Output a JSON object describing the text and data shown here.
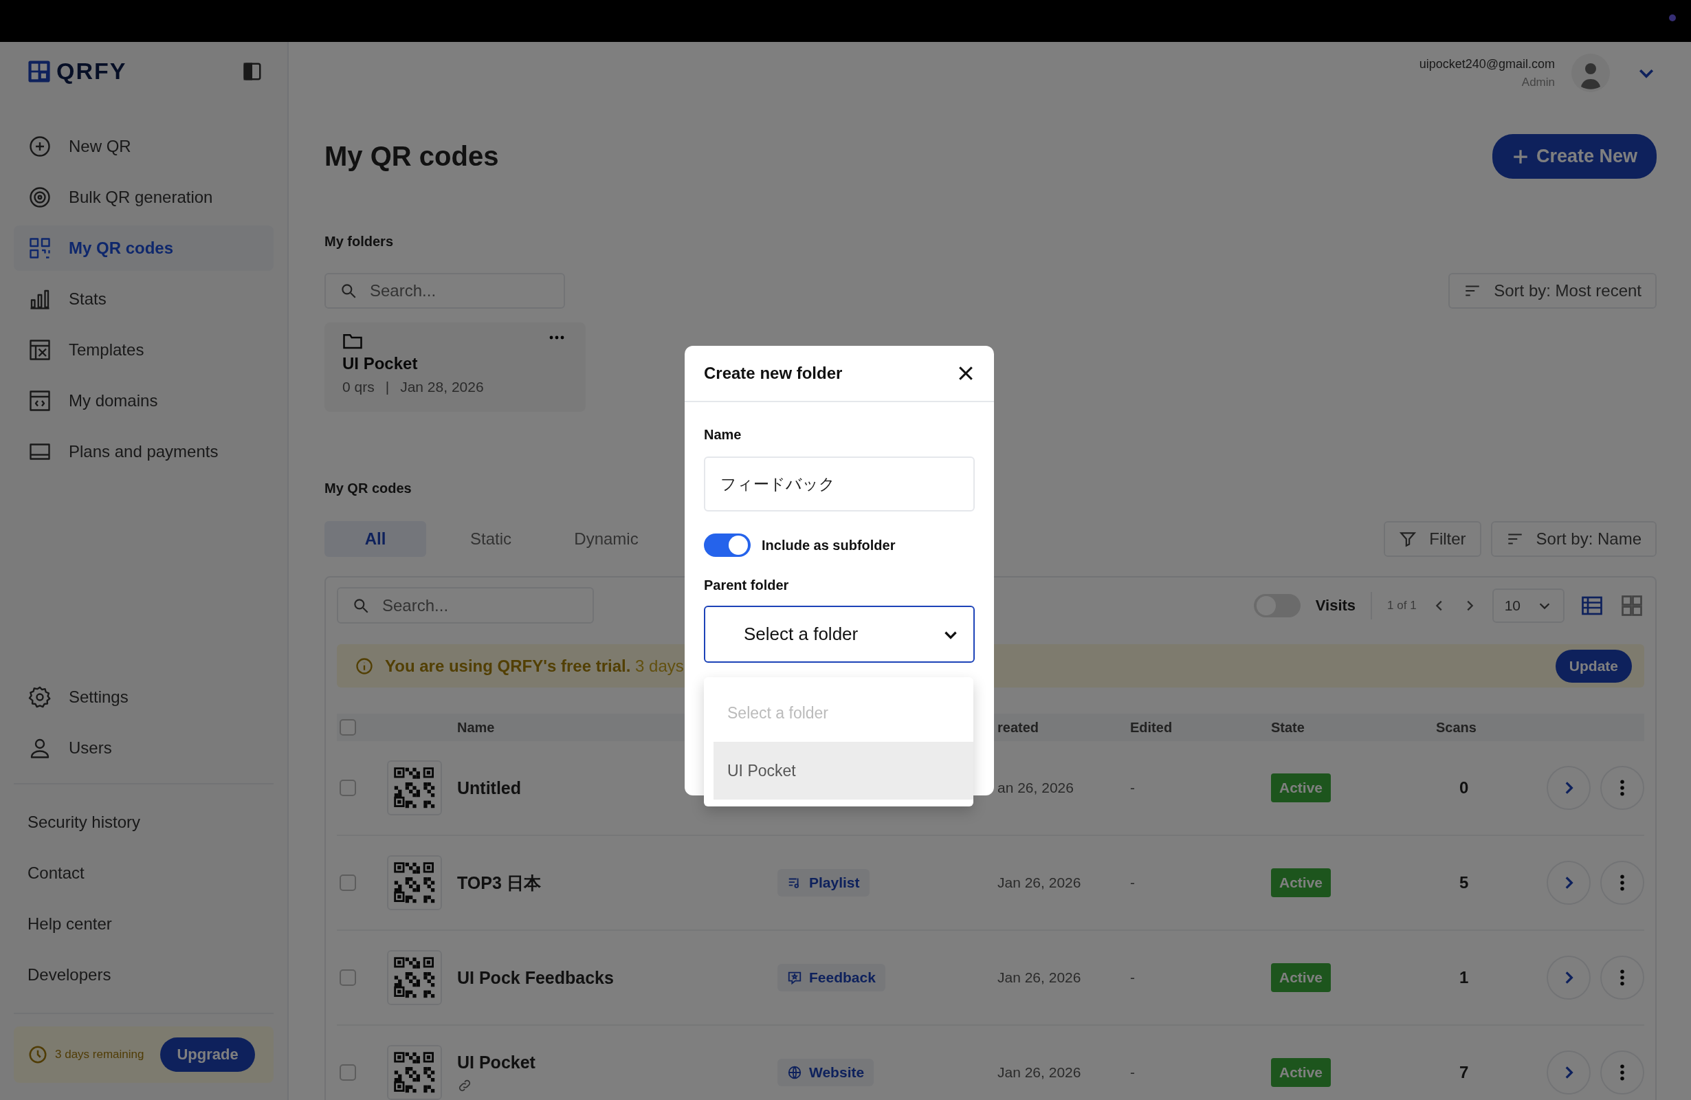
{
  "logo": {
    "text": "QRFY"
  },
  "sidebar": {
    "nav": [
      {
        "label": "New QR",
        "selected": false
      },
      {
        "label": "Bulk QR generation",
        "selected": false
      },
      {
        "label": "My QR codes",
        "selected": true
      },
      {
        "label": "Stats",
        "selected": false
      },
      {
        "label": "Templates",
        "selected": false
      },
      {
        "label": "My domains",
        "selected": false
      },
      {
        "label": "Plans and payments",
        "selected": false
      }
    ],
    "settings": [
      {
        "label": "Settings",
        "selected": false
      },
      {
        "label": "Users",
        "selected": false
      }
    ],
    "links": [
      "Security history",
      "Contact",
      "Help center",
      "Developers"
    ],
    "trial": {
      "text": "3 days remaining",
      "button": "Upgrade"
    }
  },
  "user": {
    "email": "uipocket240@gmail.com",
    "role": "Admin"
  },
  "page": {
    "title": "My QR codes",
    "create_button": "Create New"
  },
  "folders": {
    "label": "My folders",
    "search_placeholder": "Search...",
    "sort": "Sort by: Most recent",
    "items": [
      {
        "name": "UI Pocket",
        "count": "0 qrs",
        "separator": "|",
        "date": "Jan 28, 2026"
      }
    ]
  },
  "qr_codes": {
    "label": "My QR codes",
    "tabs": [
      {
        "label": "All",
        "selected": true
      },
      {
        "label": "Static",
        "selected": false
      },
      {
        "label": "Dynamic",
        "selected": false
      }
    ],
    "filter": "Filter",
    "sort": "Sort by: Name",
    "search_placeholder": "Search...",
    "visits": {
      "label": "Visits",
      "on": false
    },
    "pagination": "1 of 1",
    "page_size": "10",
    "views": [
      {
        "kind": "list",
        "selected": true
      },
      {
        "kind": "grid",
        "selected": false
      }
    ],
    "banner": {
      "text": "**You are using QRFY's free trial.** 3 days",
      "button": "Update"
    },
    "header_checked": false,
    "columns": [
      {
        "kind": "name",
        "label": "Name"
      },
      {
        "kind": "created",
        "label": "reated"
      },
      {
        "kind": "edited",
        "label": "Edited"
      },
      {
        "kind": "state",
        "label": "State"
      },
      {
        "kind": "scans",
        "label": "Scans"
      }
    ],
    "rows": [
      {
        "name": "Untitled",
        "checked": false,
        "created": "an 26, 2026",
        "edited": "-",
        "state": "Active",
        "scans": "0",
        "link": false
      },
      {
        "name": "TOP3 日本",
        "checked": false,
        "type": {
          "kind": "playlist",
          "label": "Playlist"
        },
        "created": "Jan 26, 2026",
        "edited": "-",
        "state": "Active",
        "scans": "5",
        "link": false
      },
      {
        "name": "UI Pock Feedbacks",
        "checked": false,
        "type": {
          "kind": "feedback",
          "label": "Feedback"
        },
        "created": "Jan 26, 2026",
        "edited": "-",
        "state": "Active",
        "scans": "1",
        "link": false
      },
      {
        "name": "UI Pocket",
        "checked": false,
        "type": {
          "kind": "website",
          "label": "Website"
        },
        "created": "Jan 26, 2026",
        "edited": "-",
        "state": "Active",
        "scans": "7",
        "link": true
      }
    ]
  },
  "modal": {
    "title": "Create new folder",
    "name_label": "Name",
    "name_value": "フィードバック",
    "subfolder": {
      "label": "Include as subfolder",
      "on": true
    },
    "parent_label": "Parent folder",
    "parent_value": "Select a folder",
    "options": [
      {
        "label": "Select a folder",
        "disabled": true,
        "selected": false
      },
      {
        "label": "UI Pocket",
        "disabled": false,
        "selected": true
      }
    ]
  }
}
